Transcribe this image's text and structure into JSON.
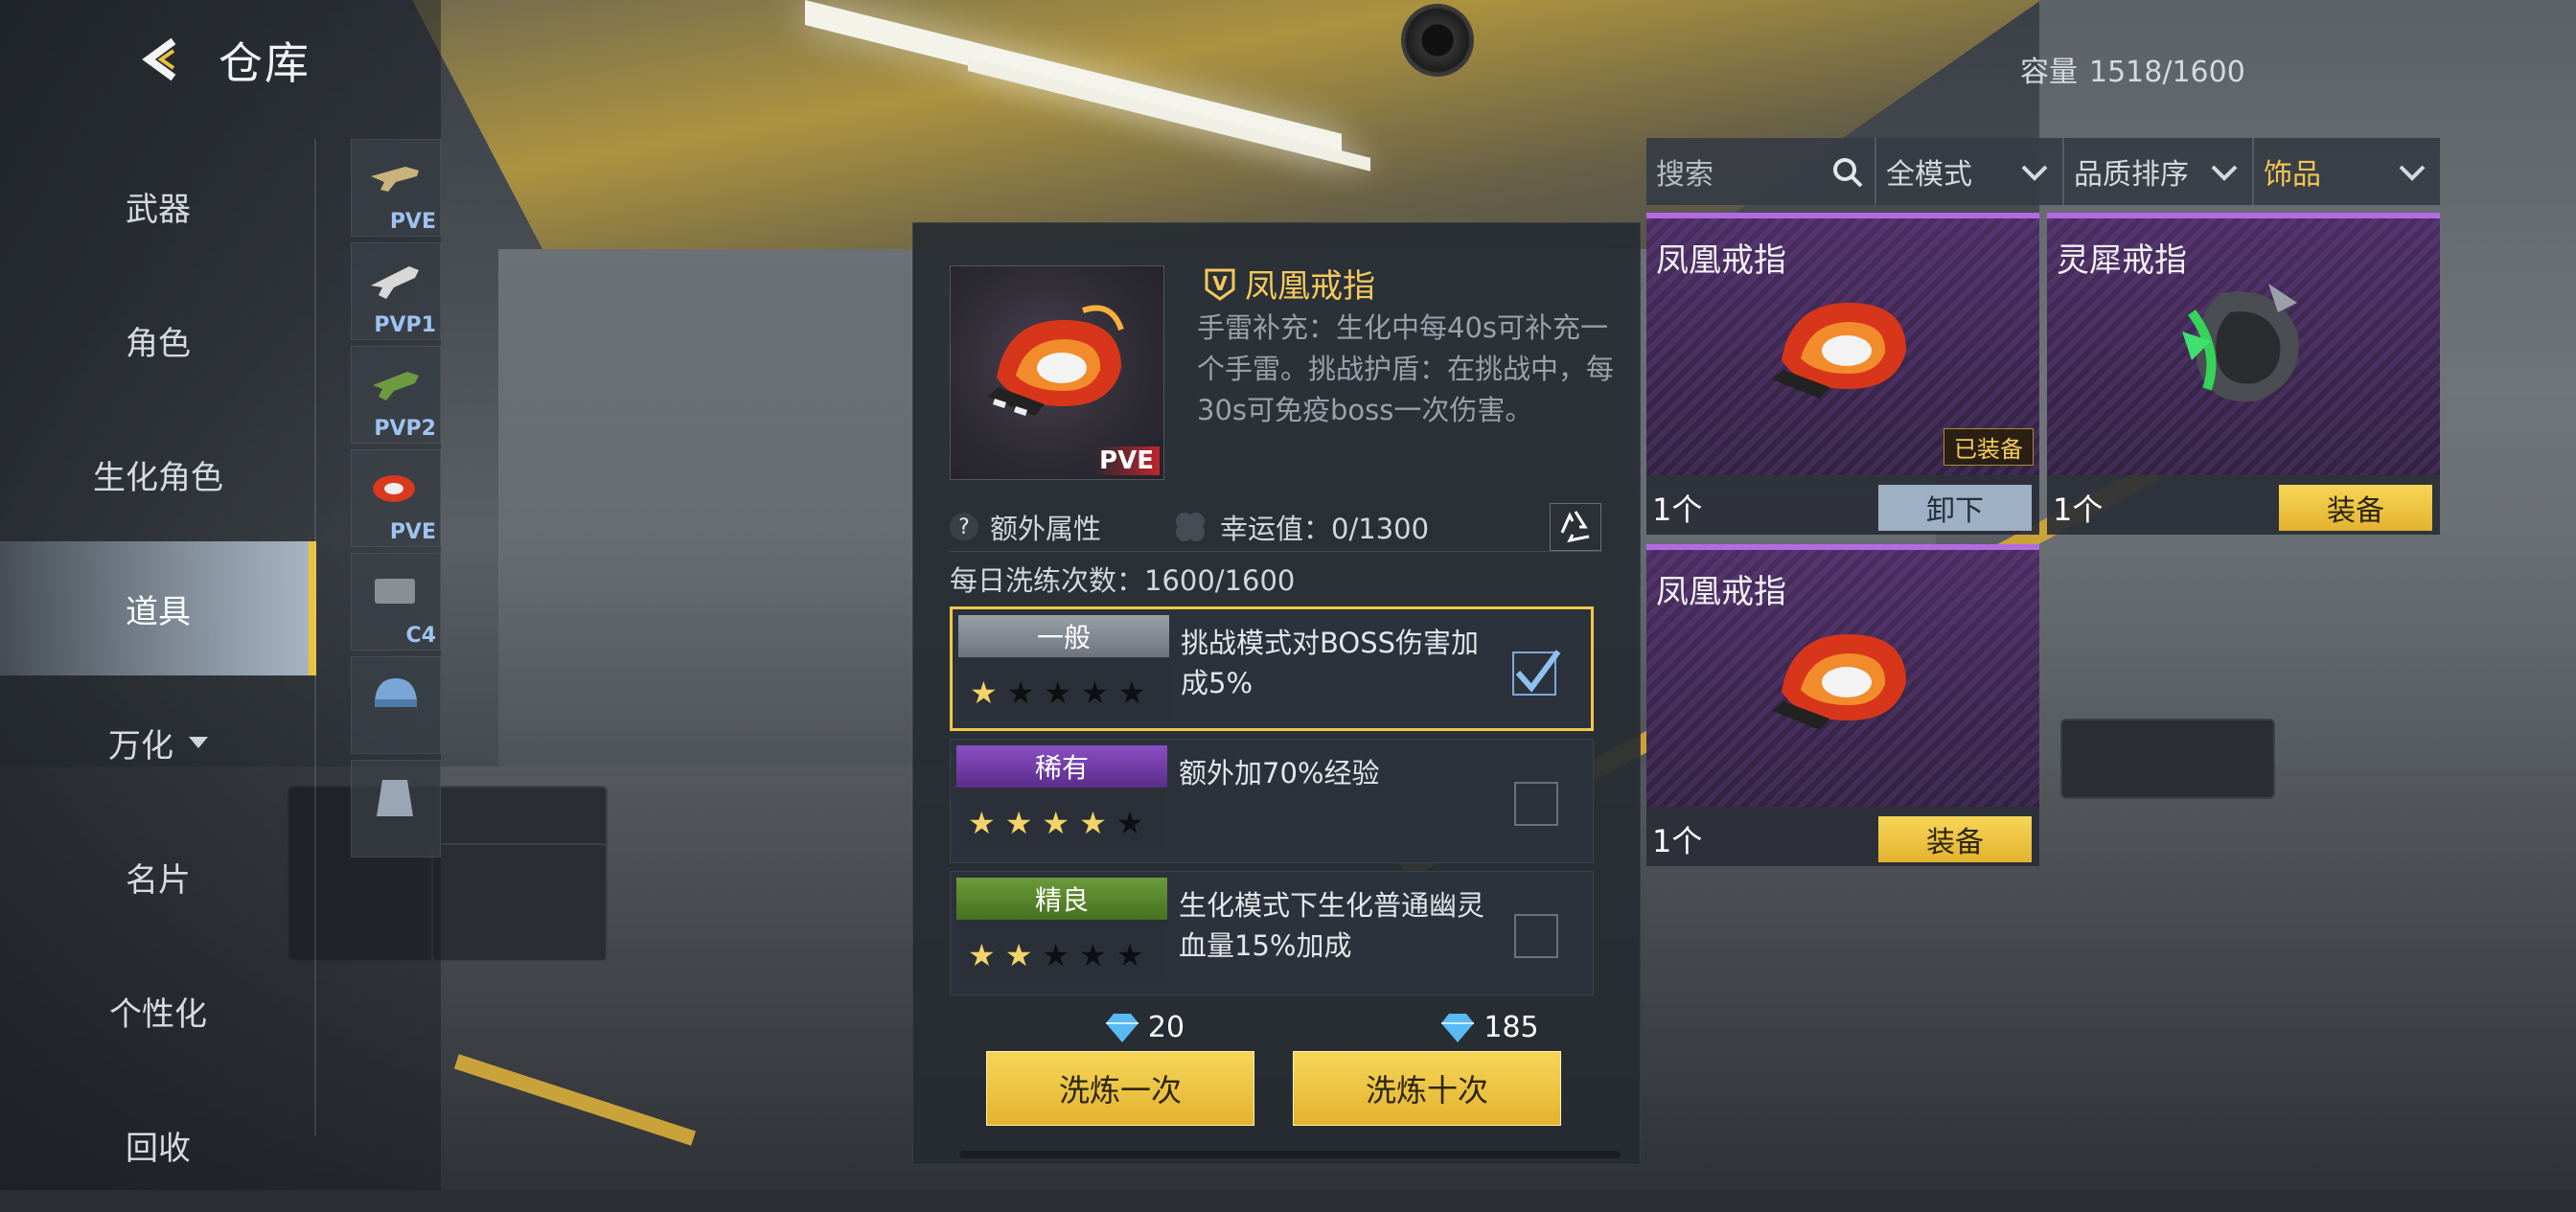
{
  "header": {
    "title": "仓库",
    "capacity_label": "容量",
    "capacity_value": "1518/1600"
  },
  "nav": {
    "items": [
      {
        "label": "武器",
        "active": false
      },
      {
        "label": "角色",
        "active": false
      },
      {
        "label": "生化角色",
        "active": false
      },
      {
        "label": "道具",
        "active": true
      },
      {
        "label": "万化",
        "active": false,
        "has_caret": true
      },
      {
        "label": "名片",
        "active": false
      },
      {
        "label": "个性化",
        "active": false
      },
      {
        "label": "回收",
        "active": false
      }
    ],
    "thumbs": [
      {
        "label": "PVE"
      },
      {
        "label": "PVP1"
      },
      {
        "label": "PVP2"
      },
      {
        "label": "PVE"
      },
      {
        "label": "C4"
      },
      {
        "label": ""
      },
      {
        "label": ""
      }
    ]
  },
  "detail": {
    "badge": "PVE",
    "name": "凤凰戒指",
    "desc": "手雷补充：生化中每40s可补充一个手雷。挑战护盾：在挑战中，每30s可免疫boss一次伤害。",
    "extra_attr": "额外属性",
    "luck": "幸运值：0/1300",
    "daily": "每日洗练次数：1600/1600",
    "options": [
      {
        "rank": "一般",
        "rank_class": "common",
        "stars_on": 1,
        "stars_total": 5,
        "text": "挑战模式对BOSS伤害加成5%",
        "checked": true
      },
      {
        "rank": "稀有",
        "rank_class": "rare",
        "stars_on": 4,
        "stars_total": 5,
        "text": "额外加70%经验",
        "checked": false
      },
      {
        "rank": "精良",
        "rank_class": "fine",
        "stars_on": 2,
        "stars_total": 5,
        "text": "生化模式下生化普通幽灵血量15%加成",
        "checked": false
      }
    ],
    "cost_once": "20",
    "cost_ten": "185",
    "btn_once": "洗炼一次",
    "btn_ten": "洗炼十次"
  },
  "filters": {
    "search_placeholder": "搜索",
    "mode": "全模式",
    "sort": "品质排序",
    "type": "饰品"
  },
  "grid": [
    {
      "name": "凤凰戒指",
      "count": "1个",
      "action": "卸下",
      "equipped_badge": "已装备",
      "icon": "phoenix-ring"
    },
    {
      "name": "灵犀戒指",
      "count": "1个",
      "action": "装备",
      "equipped_badge": "",
      "icon": "lingxi-ring"
    },
    {
      "name": "凤凰戒指",
      "count": "1个",
      "action": "装备",
      "equipped_badge": "",
      "icon": "phoenix-ring"
    }
  ],
  "colors": {
    "accent": "#e9c13e",
    "purple": "#b36be2",
    "name_gold": "#f6c95c"
  }
}
